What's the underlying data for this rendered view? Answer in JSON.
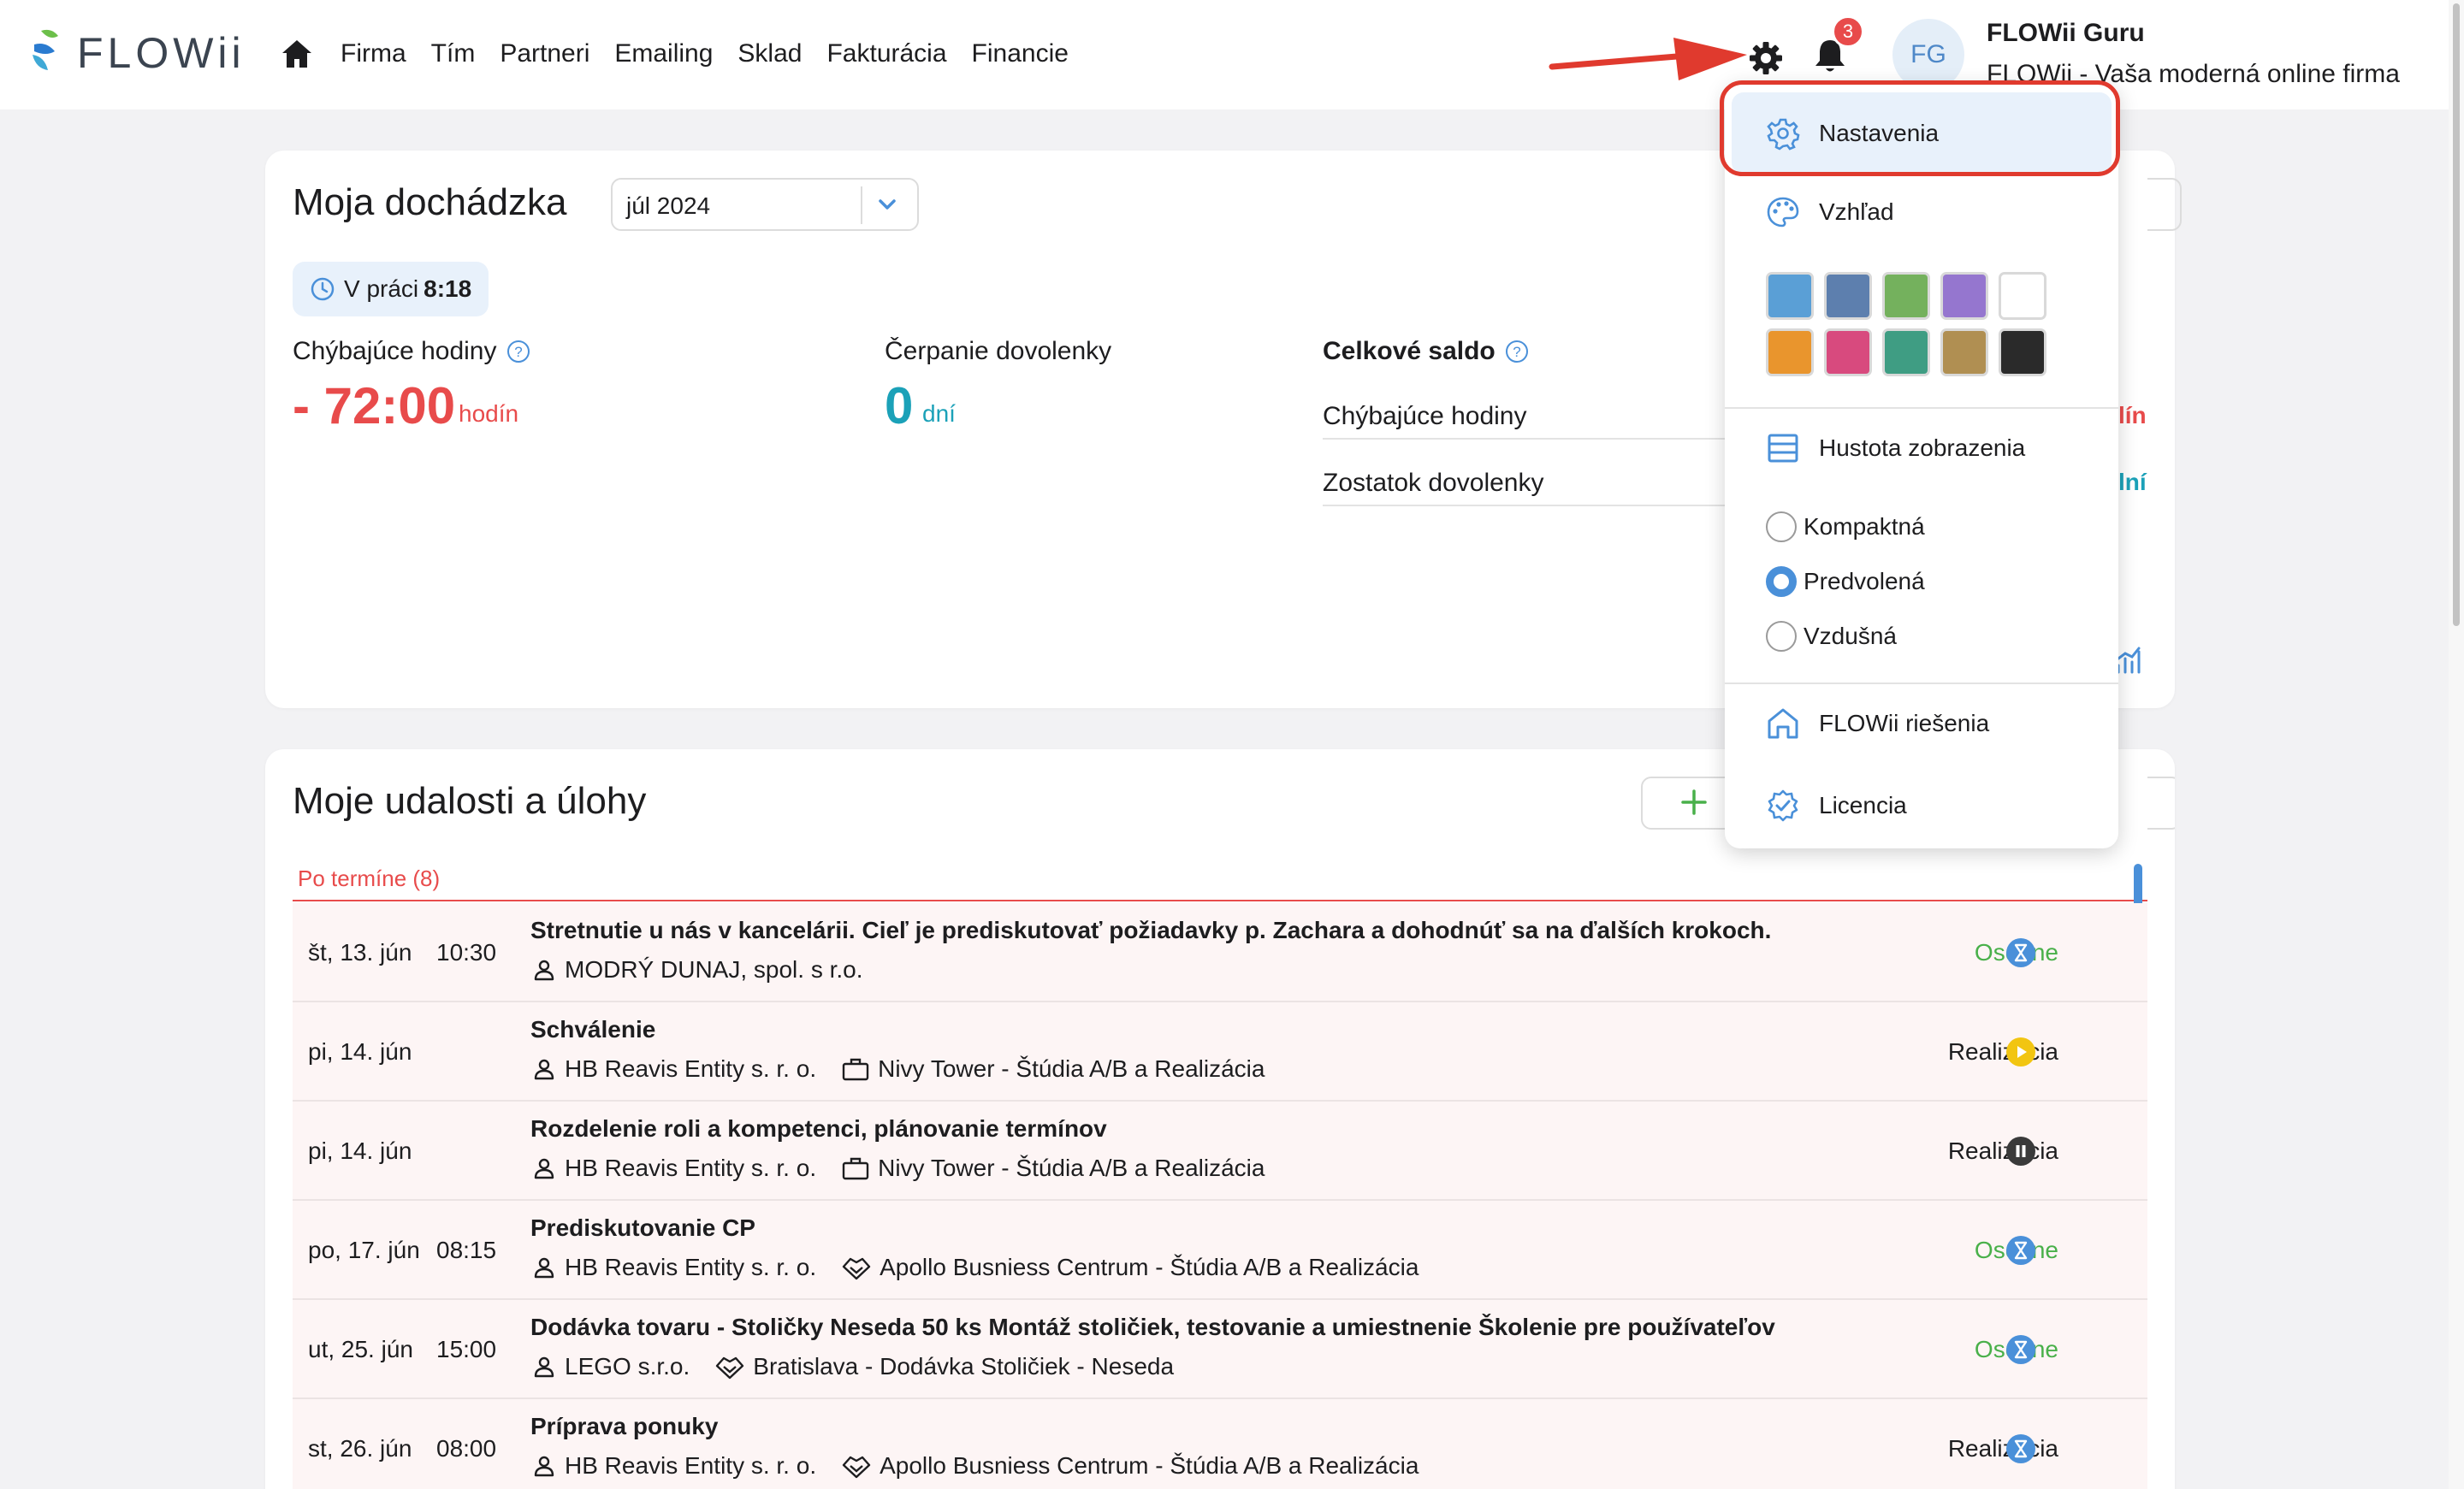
{
  "app": {
    "logo_text": "FLOWii"
  },
  "nav": {
    "items": [
      "Firma",
      "Tím",
      "Partneri",
      "Emailing",
      "Sklad",
      "Fakturácia",
      "Financie"
    ]
  },
  "header": {
    "notifications_count": "3",
    "avatar_initials": "FG",
    "user_name": "FLOWii Guru",
    "user_subtitle": "FLOWii - Vaša moderná online firma"
  },
  "attendance": {
    "title": "Moja dochádzka",
    "month": "júl 2024",
    "in_work_label": "V práci",
    "in_work_time": "8:18",
    "missing_hours_label": "Chýbajúce hodiny",
    "missing_hours_value": "- 72:00",
    "missing_hours_unit": "hodín",
    "vacation_label": "Čerpanie dovolenky",
    "vacation_value": "0",
    "vacation_unit": "dní",
    "saldo_title": "Celkové saldo",
    "saldo_rows": [
      "Chýbajúce hodiny",
      "Zostatok dovolenky"
    ],
    "saldo_frag_1": "lín",
    "saldo_frag_2": "lní"
  },
  "events": {
    "title": "Moje udalosti a úlohy",
    "add_label": "+",
    "overdue_label": "Po termíne (8)",
    "rows": [
      {
        "date": "št, 13. jún",
        "time": "10:30",
        "title": "Stretnutie u nás v kancelárii. Cieľ je prediskutovať požiadavky p. Zachara a dohodnúť sa na ďalších krokoch.",
        "client": "MODRÝ DUNAJ, spol. s r.o.",
        "project": "",
        "project_icon": "",
        "status": "Osobne",
        "status_icon": "hourglass-icon",
        "status_color": "#4a90d9"
      },
      {
        "date": "pi, 14. jún",
        "time": "",
        "title": "Schválenie",
        "client": "HB Reavis Entity s. r. o.",
        "project": "Nivy Tower - Štúdia A/B a Realizácia",
        "project_icon": "briefcase-icon",
        "status": "Realizácia",
        "status_icon": "play-icon",
        "status_color": "#f2c511"
      },
      {
        "date": "pi, 14. jún",
        "time": "",
        "title": "Rozdelenie roli a kompetenci, plánovanie termínov",
        "client": "HB Reavis Entity s. r. o.",
        "project": "Nivy Tower - Štúdia A/B a Realizácia",
        "project_icon": "briefcase-icon",
        "status": "Realizácia",
        "status_icon": "pause-icon",
        "status_color": "#3a3a3a"
      },
      {
        "date": "po, 17. jún",
        "time": "08:15",
        "title": "Prediskutovanie CP",
        "client": "HB Reavis Entity s. r. o.",
        "project": "Apollo Busniess Centrum - Štúdia A/B a Realizácia",
        "project_icon": "handshake-icon",
        "status": "Osobne",
        "status_icon": "hourglass-icon",
        "status_color": "#4a90d9"
      },
      {
        "date": "ut, 25. jún",
        "time": "15:00",
        "title": "Dodávka tovaru - Stoličky Neseda 50 ks Montáž stoličiek, testovanie a umiestnenie Školenie pre používateľov",
        "client": "LEGO s.r.o.",
        "project": "Bratislava - Dodávka Stoličiek - Neseda",
        "project_icon": "handshake-icon",
        "status": "Osobne",
        "status_icon": "hourglass-icon",
        "status_color": "#4a90d9"
      },
      {
        "date": "st, 26. jún",
        "time": "08:00",
        "title": "Príprava ponuky",
        "client": "HB Reavis Entity s. r. o.",
        "project": "Apollo Busniess Centrum - Štúdia A/B a Realizácia",
        "project_icon": "handshake-icon",
        "status": "Realizácia",
        "status_icon": "hourglass-icon",
        "status_color": "#4a90d9"
      }
    ]
  },
  "settings_menu": {
    "settings_label": "Nastavenia",
    "appearance_label": "Vzhľad",
    "theme_colors": [
      "#5a9fd6",
      "#5d7fae",
      "#74b15d",
      "#9576cf",
      "#ffffff",
      "#e9952d",
      "#d84a7e",
      "#3f9d83",
      "#b08f52",
      "#2a2a2a"
    ],
    "density_label": "Hustota zobrazenia",
    "density_options": [
      "Kompaktná",
      "Predvolená",
      "Vzdušná"
    ],
    "density_selected": "Predvolená",
    "solutions_label": "FLOWii riešenia",
    "license_label": "Licencia"
  },
  "colors": {
    "accent": "#4a90d9",
    "danger": "#e84b4b",
    "teal": "#1ba1b8",
    "success": "#49b04a",
    "highlight_ring": "#e03a2e"
  }
}
